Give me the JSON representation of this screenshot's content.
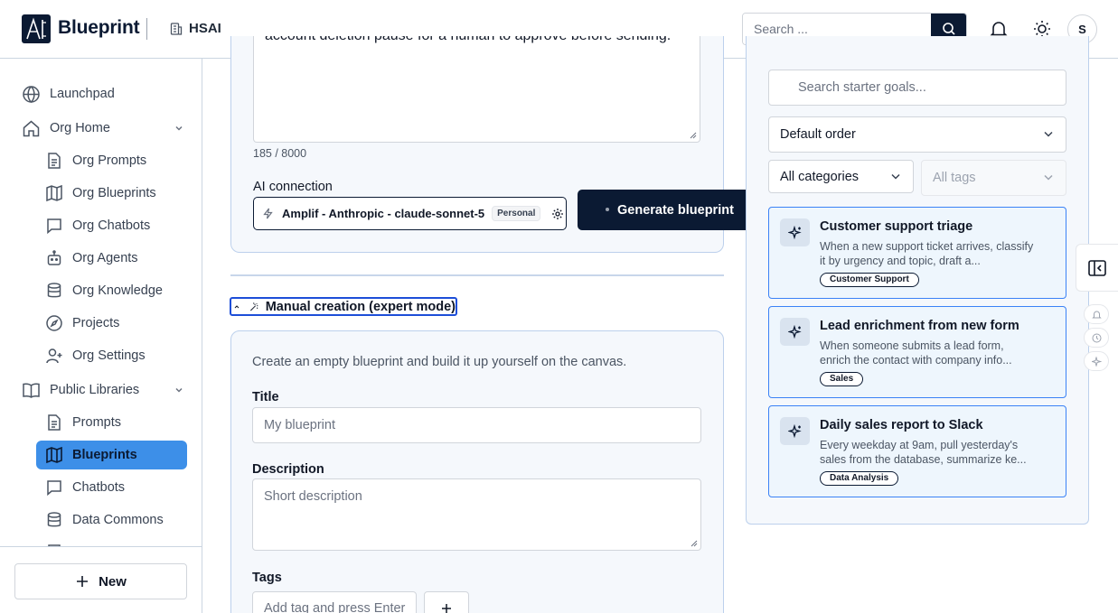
{
  "header": {
    "app_name": "Blueprint",
    "org_name": "HSAI",
    "search_placeholder": "Search ...",
    "avatar_initial": "S"
  },
  "sidebar": {
    "items": [
      {
        "label": "Launchpad",
        "icon": "globe-icon"
      },
      {
        "label": "Org Home",
        "icon": "home-icon",
        "expanded": true
      },
      {
        "label": "Org Prompts",
        "icon": "document-icon"
      },
      {
        "label": "Org Blueprints",
        "icon": "map-icon"
      },
      {
        "label": "Org Chatbots",
        "icon": "chat-icon"
      },
      {
        "label": "Org Agents",
        "icon": "robot-icon"
      },
      {
        "label": "Org Knowledge",
        "icon": "database-icon"
      },
      {
        "label": "Projects",
        "icon": "compass-icon"
      },
      {
        "label": "Org Settings",
        "icon": "user-plus-icon"
      },
      {
        "label": "Public Libraries",
        "icon": "book-icon",
        "expanded": true
      },
      {
        "label": "Prompts",
        "icon": "document-icon"
      },
      {
        "label": "Blueprints",
        "icon": "map-icon",
        "active": true
      },
      {
        "label": "Chatbots",
        "icon": "chat-icon"
      },
      {
        "label": "Data Commons",
        "icon": "database-icon"
      }
    ],
    "new_label": "New"
  },
  "ai_section": {
    "prompt_text": "account deletion pause for a human to approve before sending.",
    "char_count": "185 / 8000",
    "connection_label": "AI connection",
    "connection_value": "Amplif - Anthropic - claude-sonnet-5",
    "connection_badge": "Personal",
    "generate_label": "Generate blueprint"
  },
  "manual": {
    "toggle_label": "Manual creation (expert mode)",
    "intro": "Create an empty blueprint and build it up yourself on the canvas.",
    "title_label": "Title",
    "title_placeholder": "My blueprint",
    "description_label": "Description",
    "description_placeholder": "Short description",
    "tags_label": "Tags",
    "tags_placeholder": "Add tag and press Enter"
  },
  "starter": {
    "search_placeholder": "Search starter goals...",
    "order_value": "Default order",
    "category_value": "All categories",
    "tags_value": "All tags",
    "goals": [
      {
        "title": "Customer support triage",
        "description": "When a new support ticket arrives, classify it by urgency and topic, draft a...",
        "tag": "Customer Support"
      },
      {
        "title": "Lead enrichment from new form",
        "description": "When someone submits a lead form, enrich the contact with company info...",
        "tag": "Sales"
      },
      {
        "title": "Daily sales report to Slack",
        "description": "Every weekday at 9am, pull yesterday's sales from the database, summarize ke...",
        "tag": "Data Analysis"
      }
    ]
  },
  "colors": {
    "brand_navy": "#0b1a33",
    "active_blue": "#3d8fe8",
    "card_border": "#bcd0ec",
    "goal_border": "#3b82f6"
  }
}
